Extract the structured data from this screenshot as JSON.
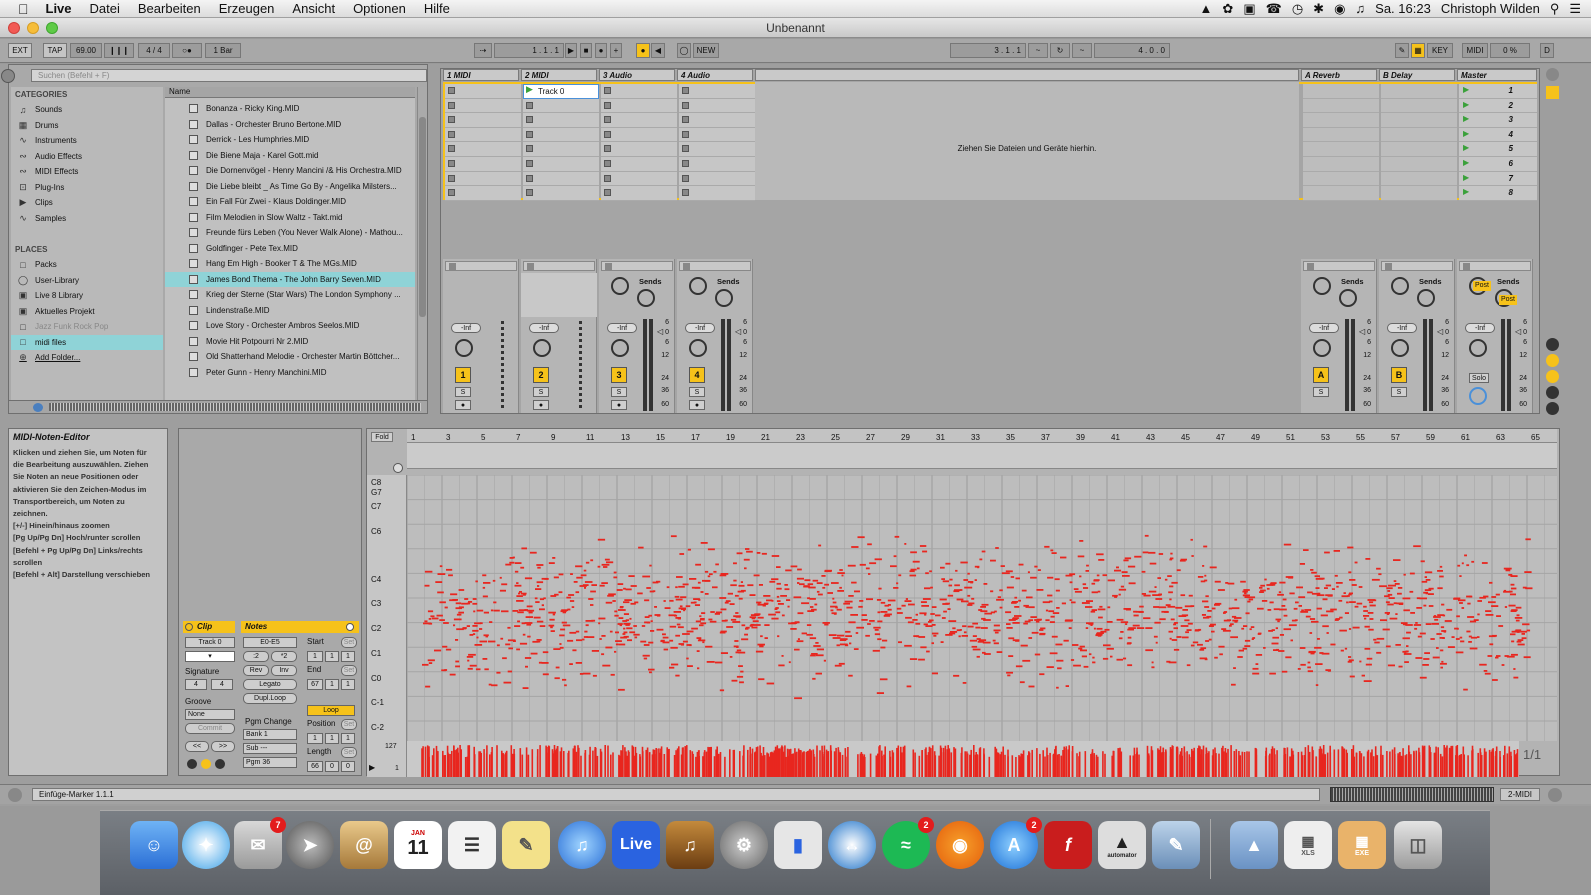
{
  "menubar": {
    "apple": "",
    "app": "Live",
    "items": [
      "Datei",
      "Bearbeiten",
      "Erzeugen",
      "Ansicht",
      "Optionen",
      "Hilfe"
    ],
    "clock": "Sa. 16:23",
    "user": "Christoph Wilden"
  },
  "window": {
    "title": "Unbenannt"
  },
  "transport": {
    "ext": "EXT",
    "tap": "TAP",
    "tempo": "69.00",
    "sig": "4 / 4",
    "quant": "1 Bar",
    "pos": "1 .   1 .   1",
    "new": "NEW",
    "loopstart": "3 .   1 .   1",
    "looplen": "4 .   0 .   0",
    "key": "KEY",
    "midi": "MIDI",
    "cpu": "0 %",
    "d": "D"
  },
  "browser": {
    "search_placeholder": "Suchen (Befehl + F)",
    "categories_title": "CATEGORIES",
    "categories": [
      "Sounds",
      "Drums",
      "Instruments",
      "Audio Effects",
      "MIDI Effects",
      "Plug-Ins",
      "Clips",
      "Samples"
    ],
    "places_title": "PLACES",
    "places": [
      "Packs",
      "User-Library",
      "Live 8 Library",
      "Aktuelles Projekt",
      "Jazz Funk Rock Pop",
      "midi files",
      "Add Folder..."
    ],
    "name_header": "Name",
    "files": [
      "Bonanza - Ricky King.MID",
      "Dallas - Orchester Bruno Bertone.MID",
      "Derrick - Les Humphries.MID",
      "Die Biene Maja - Karel Gott.mid",
      "Die Dornenvögel - Henry Mancini /& His Orchestra.MID",
      "Die Liebe bleibt _ As Time Go By - Angelika Milsters...",
      "Ein Fall Für Zwei - Klaus Doldinger.MID",
      "Film Melodien in Slow Waltz - Takt.mid",
      "Freunde fürs Leben (You Never Walk Alone) - Mathou...",
      "Goldfinger - Pete Tex.MID",
      "Hang Em High - Booker T & The MGs.MID",
      "James Bond Thema - The John Barry Seven.MID",
      "Krieg der Sterne (Star Wars) The London Symphony ...",
      "Lindenstraße.MID",
      "Love Story - Orchester Ambros Seelos.MID",
      "Movie Hit Potpourri Nr 2.MID",
      "Old Shatterhand Melodie - Orchester Martin Böttcher...",
      "Peter Gunn - Henry Manchini.MID"
    ]
  },
  "session": {
    "tracks": [
      "1 MIDI",
      "2 MIDI",
      "3 Audio",
      "4 Audio"
    ],
    "returns": [
      "A Reverb",
      "B Delay"
    ],
    "master": "Master",
    "clip_name": "Track 0",
    "drop_hint": "Ziehen Sie Dateien und Geräte hierhin.",
    "scenes": [
      "1",
      "2",
      "3",
      "4",
      "5",
      "6",
      "7",
      "8"
    ],
    "sends": "Sends",
    "inf": "-Inf",
    "post": "Post",
    "solo": "Solo",
    "scale": [
      "6",
      "0",
      "6",
      "12",
      "24",
      "36",
      "60"
    ],
    "s": "S",
    "track_nums": [
      "1",
      "2",
      "3",
      "4"
    ],
    "return_letters": [
      "A",
      "B"
    ]
  },
  "info": {
    "title": "MIDI-Noten-Editor",
    "lines": [
      "Klicken und ziehen Sie, um Noten für",
      "die Bearbeitung auszuwählen. Ziehen",
      "Sie Noten an neue Positionen oder",
      "aktivieren Sie den Zeichen-Modus im",
      "Transportbereich, um Noten zu",
      "zeichnen.",
      "[+/-] Hinein/hinaus zoomen",
      "[Pg Up/Pg Dn] Hoch/runter scrollen",
      "[Befehl + Pg Up/Pg Dn] Links/rechts",
      "scrollen",
      "[Befehl + Alt] Darstellung verschieben"
    ]
  },
  "clip": {
    "title": "Clip",
    "name": "Track 0",
    "signature": "Signature",
    "sig_num": "4",
    "sig_den": "4",
    "groove": "Groove",
    "groove_val": "None",
    "commit": "Commit",
    "notes_title": "Notes",
    "range": "E0-E5",
    "div2": ":2",
    "mul2": "*2",
    "rev": "Rev",
    "inv": "Inv",
    "legato": "Legato",
    "dupl": "Dupl.Loop",
    "pgm_change": "Pgm Change",
    "bank": "Bank 1",
    "sub": "Sub ---",
    "pgm": "Pgm 36",
    "start": "Start",
    "end": "End",
    "set": "Set",
    "loop": "Loop",
    "position": "Position",
    "length": "Length",
    "start_val": [
      "1",
      "1",
      "1"
    ],
    "end_val": [
      "67",
      "1",
      "1"
    ],
    "pos_val": [
      "1",
      "1",
      "1"
    ],
    "len_val": [
      "66",
      "0",
      "0"
    ]
  },
  "editor": {
    "fold": "Fold",
    "ruler": [
      "1",
      "3",
      "5",
      "7",
      "9",
      "11",
      "13",
      "15",
      "17",
      "19",
      "21",
      "23",
      "25",
      "27",
      "29",
      "31",
      "33",
      "35",
      "37",
      "39",
      "41",
      "43",
      "45",
      "47",
      "49",
      "51",
      "53",
      "55",
      "57",
      "59",
      "61",
      "63",
      "65"
    ],
    "notes": [
      "C8",
      "G7",
      "C7",
      "C6",
      "C4",
      "C3",
      "C2",
      "C1",
      "C0",
      "C-1",
      "C-2"
    ],
    "vel_max": "127",
    "vel_min": "1",
    "zoom": "1/1"
  },
  "status": {
    "text": "Einfüge-Marker 1.1.1",
    "track": "2-MIDI"
  },
  "dock": {
    "live": "Live",
    "calendar": "11",
    "calendar_month": "JAN",
    "badges": [
      "7",
      "2",
      "2"
    ],
    "xls": "XLS",
    "exe": "EXE",
    "automator": "automator"
  },
  "colors": {
    "accent": "#f6c21a",
    "note": "#e8261f",
    "selection": "#8fd3d7"
  }
}
